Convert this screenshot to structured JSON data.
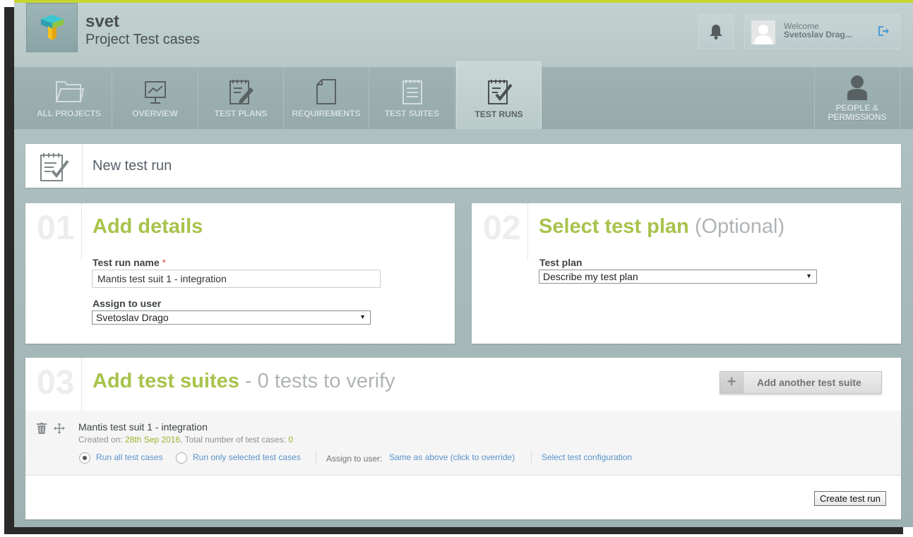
{
  "header": {
    "user_short": "svet",
    "project_name": "Project Test cases",
    "welcome_label": "Welcome",
    "welcome_name": "Svetoslav Drag..."
  },
  "nav": {
    "all_projects": "ALL PROJECTS",
    "overview": "OVERVIEW",
    "test_plans": "TEST PLANS",
    "requirements": "REQUIREMENTS",
    "test_suites": "TEST SUITES",
    "test_runs": "TEST RUNS",
    "people_line1": "PEOPLE &",
    "people_line2": "PERMISSIONS",
    "active": "test_runs"
  },
  "page_title": "New test run",
  "step1": {
    "number": "01",
    "title": "Add details",
    "name_label": "Test run name",
    "required_mark": "*",
    "name_value": "Mantis test suit 1 - integration",
    "assign_label": "Assign to user",
    "assign_value": "Svetoslav Drago"
  },
  "step2": {
    "number": "02",
    "title": "Select test plan",
    "title_suffix": "(Optional)",
    "plan_label": "Test plan",
    "plan_value": "Describe my test plan"
  },
  "step3": {
    "number": "03",
    "title": "Add test suites",
    "subtitle": "- 0 tests to verify",
    "add_button": "Add another test suite",
    "suite": {
      "name": "Mantis test suit 1 - integration",
      "created_prefix": "Created on:",
      "created_date": "28th Sep 2016",
      "count_prefix": ", Total number of test cases:",
      "count": "0",
      "run_all": "Run all test cases",
      "run_selected": "Run only selected test cases",
      "assign_label": "Assign to user:",
      "assign_link": "Same as above (click to override)",
      "config_link": "Select test configuration",
      "run_mode": "all"
    },
    "create_button": "Create test run"
  },
  "colors": {
    "accent_green": "#a8c34c",
    "top_bar": "#c6d631",
    "link_blue": "#5a93c9",
    "frame_bg": "#aabcbc"
  }
}
